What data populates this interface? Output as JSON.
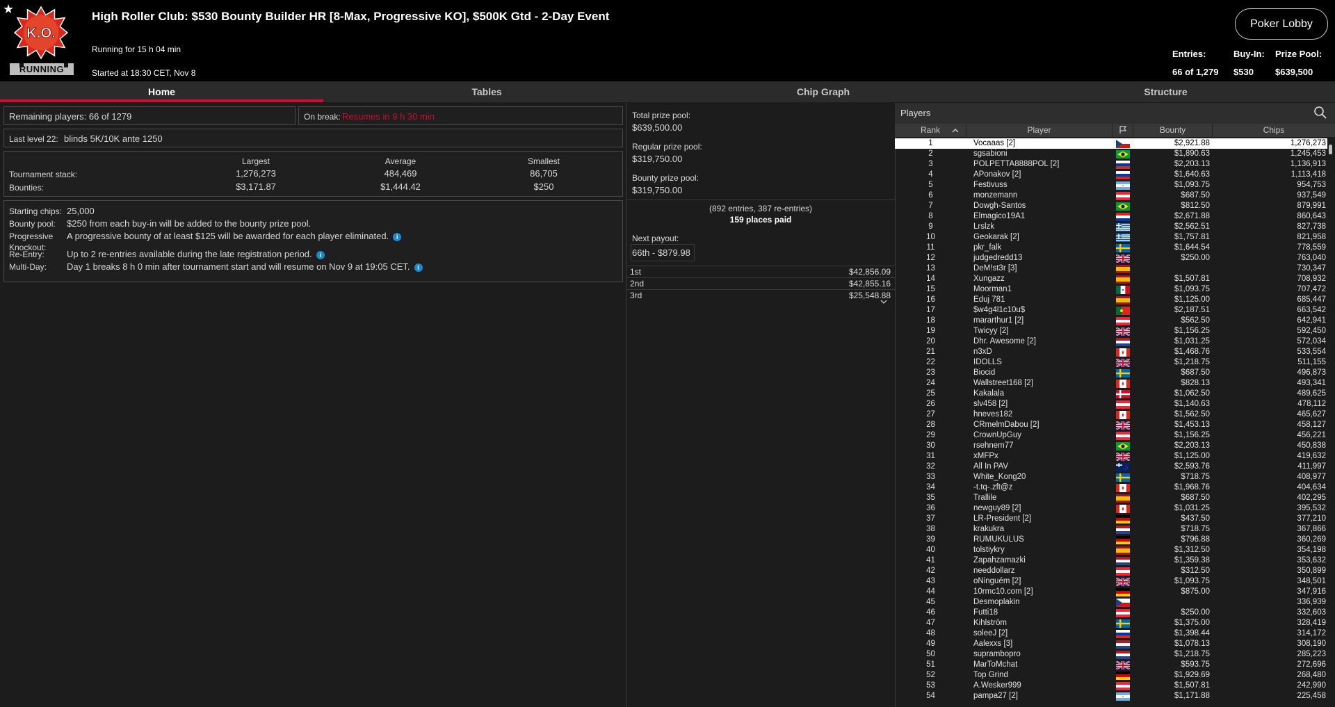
{
  "header": {
    "star": "★",
    "logo_text": "K.O.",
    "status": "RUNNING",
    "title": "High Roller Club: $530 Bounty Builder HR [8-Max, Progressive KO], $500K Gtd - 2-Day Event",
    "running_for": "Running for 15 h 04 min",
    "started": "Started at 18:30 CET, Nov 8",
    "lobby_button": "Poker Lobby",
    "entries_label": "Entries:",
    "entries_value": "66 of 1,279",
    "buyin_label": "Buy-In:",
    "buyin_value": "$530",
    "prizepool_label": "Prize Pool:",
    "prizepool_value": "$639,500"
  },
  "tabs": [
    "Home",
    "Tables",
    "Chip Graph",
    "Structure"
  ],
  "home": {
    "remaining": "Remaining players: 66 of 1279",
    "on_break_label": "On break:",
    "on_break_value": "Resumes in 9 h 30 min",
    "last_level_label": "Last level 22:",
    "last_level_value": "blinds 5K/10K ante 1250",
    "stack_headers": [
      "Largest",
      "Average",
      "Smallest"
    ],
    "stack_label": "Tournament stack:",
    "stack_values": [
      "1,276,273",
      "484,469",
      "86,705"
    ],
    "bounty_label": "Bounties:",
    "bounty_values": [
      "$3,171.87",
      "$1,444.42",
      "$250"
    ],
    "info_rows": [
      {
        "label": "Starting chips:",
        "label2": "",
        "text": "25,000",
        "info": false
      },
      {
        "label": "Bounty pool:",
        "label2": "",
        "text": "$250 from each buy-in will be added to the bounty prize pool.",
        "info": false
      },
      {
        "label": "Progressive",
        "label2": "Knockout:",
        "text": "A progressive bounty of at least $125 will be awarded for each player eliminated.",
        "info": true
      },
      {
        "label": "Re-Entry:",
        "label2": "",
        "text": "Up to 2 re-entries available during the late registration period.",
        "info": true
      },
      {
        "label": "Multi-Day:",
        "label2": "",
        "text": "Day 1 breaks 8 h 0 min after tournament start and will resume on Nov 9 at 19:05 CET.",
        "info": true
      }
    ],
    "info_icon": "i"
  },
  "prize": {
    "total_label": "Total prize pool:",
    "total_value": "$639,500.00",
    "regular_label": "Regular prize pool:",
    "regular_value": "$319,750.00",
    "bounty_label": "Bounty prize pool:",
    "bounty_value": "$319,750.00",
    "entries_note": "(892 entries, 387 re-entries)",
    "places_paid": "159 places paid",
    "next_payout_label": "Next payout:",
    "next_payout_value": "66th - $879.98",
    "payouts": [
      {
        "place": "1st",
        "amount": "$42,856.09"
      },
      {
        "place": "2nd",
        "amount": "$42,855.16"
      },
      {
        "place": "3rd",
        "amount": "$25,548.88"
      }
    ],
    "expand_icon": "chevron-down-icon"
  },
  "players": {
    "title": "Players",
    "columns": [
      "Rank",
      "Player",
      "",
      "Bounty",
      "Chips"
    ],
    "rows": [
      {
        "rank": "1",
        "player": "Vocaaas [2]",
        "flag": "cz",
        "bounty": "$2,921.88",
        "chips": "1,276,273"
      },
      {
        "rank": "2",
        "player": "sgsabioni",
        "flag": "br",
        "bounty": "$1,890.63",
        "chips": "1,245,453"
      },
      {
        "rank": "3",
        "player": "POLPETTA8888POL [2]",
        "flag": "ru",
        "bounty": "$2,203.13",
        "chips": "1,136,913"
      },
      {
        "rank": "4",
        "player": "APonakov [2]",
        "flag": "ru",
        "bounty": "$1,640.63",
        "chips": "1,113,418"
      },
      {
        "rank": "5",
        "player": "Festivuss",
        "flag": "ar",
        "bounty": "$1,093.75",
        "chips": "954,753"
      },
      {
        "rank": "6",
        "player": "monzemann",
        "flag": "at",
        "bounty": "$687.50",
        "chips": "937,549"
      },
      {
        "rank": "7",
        "player": "Dowgh-Santos",
        "flag": "br",
        "bounty": "$812.50",
        "chips": "879,991"
      },
      {
        "rank": "8",
        "player": "Elmagico19A1",
        "flag": "py",
        "bounty": "$2,671.88",
        "chips": "860,643"
      },
      {
        "rank": "9",
        "player": "Lrslzk",
        "flag": "gr",
        "bounty": "$2,562.51",
        "chips": "827,738"
      },
      {
        "rank": "10",
        "player": "Geokarak [2]",
        "flag": "gr",
        "bounty": "$1,757.81",
        "chips": "821,958"
      },
      {
        "rank": "11",
        "player": "pkr_falk",
        "flag": "se",
        "bounty": "$1,644.54",
        "chips": "778,559"
      },
      {
        "rank": "12",
        "player": "judgedredd13",
        "flag": "gb",
        "bounty": "$250.00",
        "chips": "763,040"
      },
      {
        "rank": "13",
        "player": "DeM!st3r [3]",
        "flag": "es",
        "bounty": "",
        "chips": "730,347"
      },
      {
        "rank": "14",
        "player": "Xungazz",
        "flag": "es",
        "bounty": "$1,507.81",
        "chips": "708,932"
      },
      {
        "rank": "15",
        "player": "Moorman1",
        "flag": "mx",
        "bounty": "$1,093.75",
        "chips": "707,472"
      },
      {
        "rank": "16",
        "player": "Eduj 781",
        "flag": "es",
        "bounty": "$1,125.00",
        "chips": "685,447"
      },
      {
        "rank": "17",
        "player": "$w4g4l1c10u$",
        "flag": "pt",
        "bounty": "$2,187.51",
        "chips": "663,542"
      },
      {
        "rank": "18",
        "player": "mararthur1 [2]",
        "flag": "at",
        "bounty": "$562.50",
        "chips": "642,941"
      },
      {
        "rank": "19",
        "player": "Twicyy [2]",
        "flag": "gb",
        "bounty": "$1,156.25",
        "chips": "592,450"
      },
      {
        "rank": "20",
        "player": "Dhr. Awesome [2]",
        "flag": "nl",
        "bounty": "$1,031.25",
        "chips": "572,034"
      },
      {
        "rank": "21",
        "player": "n3xD",
        "flag": "ca",
        "bounty": "$1,468.76",
        "chips": "533,554"
      },
      {
        "rank": "22",
        "player": "IDOLLS",
        "flag": "gb",
        "bounty": "$1,218.75",
        "chips": "511,155"
      },
      {
        "rank": "23",
        "player": "Biocid",
        "flag": "se",
        "bounty": "$687.50",
        "chips": "496,873"
      },
      {
        "rank": "24",
        "player": "Wallstreet168 [2]",
        "flag": "ca",
        "bounty": "$828.13",
        "chips": "493,341"
      },
      {
        "rank": "25",
        "player": "Kakalala",
        "flag": "dk",
        "bounty": "$1,062.50",
        "chips": "489,625"
      },
      {
        "rank": "26",
        "player": "slv458 [2]",
        "flag": "at",
        "bounty": "$1,140.63",
        "chips": "478,112"
      },
      {
        "rank": "27",
        "player": "hneves182",
        "flag": "ca",
        "bounty": "$1,562.50",
        "chips": "465,627"
      },
      {
        "rank": "28",
        "player": "CRmelmDabou [2]",
        "flag": "gb",
        "bounty": "$1,453.13",
        "chips": "458,127"
      },
      {
        "rank": "29",
        "player": "CrownUpGuy",
        "flag": "at",
        "bounty": "$1,156.25",
        "chips": "456,221"
      },
      {
        "rank": "30",
        "player": "rsehnem77",
        "flag": "br",
        "bounty": "$2,203.13",
        "chips": "450,838"
      },
      {
        "rank": "31",
        "player": "xMFPx",
        "flag": "gb",
        "bounty": "$1,125.00",
        "chips": "419,632"
      },
      {
        "rank": "32",
        "player": "All In PAV",
        "flag": "nz",
        "bounty": "$2,593.76",
        "chips": "411,997"
      },
      {
        "rank": "33",
        "player": "White_Kong20",
        "flag": "se",
        "bounty": "$718.75",
        "chips": "408,977"
      },
      {
        "rank": "34",
        "player": "-t.tq-.zft@z",
        "flag": "ca",
        "bounty": "$1,968.76",
        "chips": "404,634"
      },
      {
        "rank": "35",
        "player": "Trallile",
        "flag": "es",
        "bounty": "$687.50",
        "chips": "402,295"
      },
      {
        "rank": "36",
        "player": "newguy89 [2]",
        "flag": "ca",
        "bounty": "$1,031.25",
        "chips": "395,532"
      },
      {
        "rank": "37",
        "player": "LR-President [2]",
        "flag": "de",
        "bounty": "$437.50",
        "chips": "377,210"
      },
      {
        "rank": "38",
        "player": "krakukra",
        "flag": "nl",
        "bounty": "$718.75",
        "chips": "367,866"
      },
      {
        "rank": "39",
        "player": "RUMUKULUS",
        "flag": "de",
        "bounty": "$796.88",
        "chips": "360,269"
      },
      {
        "rank": "40",
        "player": "tolstiykry",
        "flag": "es",
        "bounty": "$1,312.50",
        "chips": "354,198"
      },
      {
        "rank": "41",
        "player": "Zapahzamazki",
        "flag": "nl",
        "bounty": "$1,359.38",
        "chips": "353,632"
      },
      {
        "rank": "42",
        "player": "needdollarz",
        "flag": "at",
        "bounty": "$312.50",
        "chips": "350,899"
      },
      {
        "rank": "43",
        "player": "oNinguém [2]",
        "flag": "gb",
        "bounty": "$1,093.75",
        "chips": "348,501"
      },
      {
        "rank": "44",
        "player": "10rmc10.com [2]",
        "flag": "de",
        "bounty": "$875.00",
        "chips": "347,916"
      },
      {
        "rank": "45",
        "player": "Desmoplakin",
        "flag": "cz",
        "bounty": "",
        "chips": "336,939"
      },
      {
        "rank": "46",
        "player": "Futti18",
        "flag": "at",
        "bounty": "$250.00",
        "chips": "332,603"
      },
      {
        "rank": "47",
        "player": "Kihlström",
        "flag": "se",
        "bounty": "$1,375.00",
        "chips": "328,419"
      },
      {
        "rank": "48",
        "player": "soleeJ [2]",
        "flag": "ru",
        "bounty": "$1,398.44",
        "chips": "314,172"
      },
      {
        "rank": "49",
        "player": "Aalexxs [3]",
        "flag": "nl",
        "bounty": "$1,078.13",
        "chips": "308,190"
      },
      {
        "rank": "50",
        "player": "suprambopro",
        "flag": "nl",
        "bounty": "$1,218.75",
        "chips": "285,223"
      },
      {
        "rank": "51",
        "player": "MarToMchat",
        "flag": "gb",
        "bounty": "$593.75",
        "chips": "272,696"
      },
      {
        "rank": "52",
        "player": "Top Grind",
        "flag": "de",
        "bounty": "$1,929.69",
        "chips": "268,480"
      },
      {
        "rank": "53",
        "player": "A.Wesker999",
        "flag": "at",
        "bounty": "$1,507.81",
        "chips": "242,990"
      },
      {
        "rank": "54",
        "player": "pampa27 [2]",
        "flag": "ar",
        "bounty": "$1,171.88",
        "chips": "225,458"
      }
    ]
  },
  "colors": {
    "accent_red": "#c8102e",
    "header_bg": "#000000",
    "panel_bg": "#1c1c1c",
    "info_blue": "#1c8ad0"
  }
}
